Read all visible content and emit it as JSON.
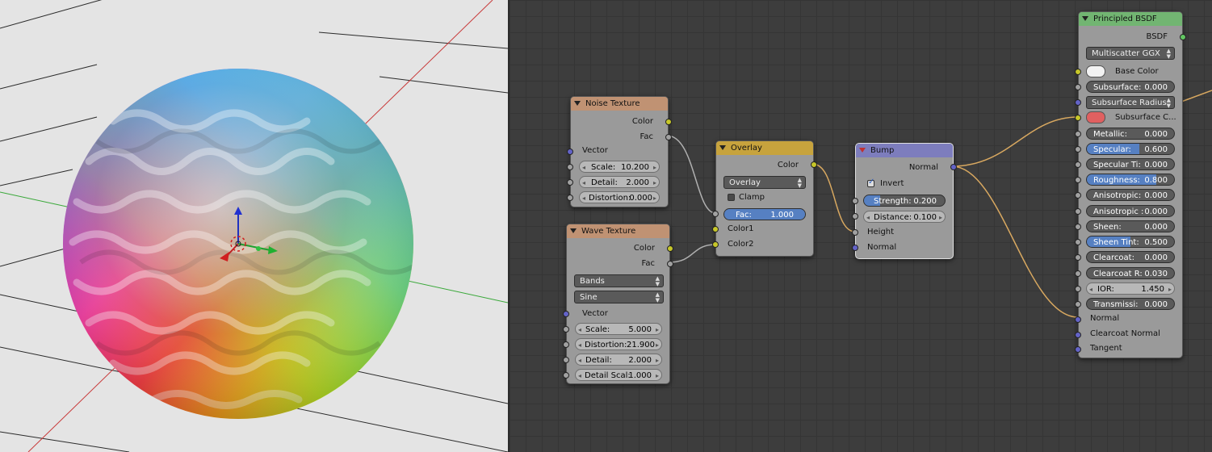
{
  "noise": {
    "title": "Noise Texture",
    "out_color": "Color",
    "out_fac": "Fac",
    "in_vector": "Vector",
    "scale_label": "Scale:",
    "scale_value": "10.200",
    "detail_label": "Detail:",
    "detail_value": "2.000",
    "distortion_label": "Distortion:",
    "distortion_value": "0.000"
  },
  "wave": {
    "title": "Wave Texture",
    "out_color": "Color",
    "out_fac": "Fac",
    "type_value": "Bands",
    "profile_value": "Sine",
    "in_vector": "Vector",
    "scale_label": "Scale:",
    "scale_value": "5.000",
    "distortion_label": "Distortion:",
    "distortion_value": "21.900",
    "detail_label": "Detail:",
    "detail_value": "2.000",
    "detail_scale_label": "Detail Scal:",
    "detail_scale_value": "1.000"
  },
  "overlay": {
    "title": "Overlay",
    "out_color": "Color",
    "blend_value": "Overlay",
    "clamp_label": "Clamp",
    "fac_label": "Fac:",
    "fac_value": "1.000",
    "fac_fraction": 1.0,
    "in_color1": "Color1",
    "in_color2": "Color2"
  },
  "bump": {
    "title": "Bump",
    "out_normal": "Normal",
    "invert_label": "Invert",
    "invert_checked": true,
    "strength_label": "Strength:",
    "strength_value": "0.200",
    "strength_fraction": 0.2,
    "distance_label": "Distance:",
    "distance_value": "0.100",
    "in_height": "Height",
    "in_normal": "Normal"
  },
  "bsdf": {
    "title": "Principled BSDF",
    "out_bsdf": "BSDF",
    "distribution_value": "Multiscatter GGX",
    "base_color_label": "Base Color",
    "base_color": "#f2f2f2",
    "subsurface_label": "Subsurface:",
    "subsurface_value": "0.000",
    "subsurface_radius_value": "Subsurface Radius",
    "subsurface_color_label": "Subsurface C...",
    "subsurface_color": "#e06060",
    "metallic_label": "Metallic:",
    "metallic_value": "0.000",
    "specular_label": "Specular:",
    "specular_value": "0.600",
    "specular_fraction": 0.6,
    "specular_tint_label": "Specular Ti:",
    "specular_tint_value": "0.000",
    "roughness_label": "Roughness:",
    "roughness_value": "0.800",
    "roughness_fraction": 0.8,
    "anisotropic_label": "Anisotropic:",
    "anisotropic_value": "0.000",
    "anisotropic_rot_label": "Anisotropic :",
    "anisotropic_rot_value": "0.000",
    "sheen_label": "Sheen:",
    "sheen_value": "0.000",
    "sheen_tint_label": "Sheen Tint:",
    "sheen_tint_value": "0.500",
    "sheen_tint_fraction": 0.5,
    "clearcoat_label": "Clearcoat:",
    "clearcoat_value": "0.000",
    "clearcoat_rough_label": "Clearcoat R:",
    "clearcoat_rough_value": "0.030",
    "ior_label": "IOR:",
    "ior_value": "1.450",
    "transmission_label": "Transmissi:",
    "transmission_value": "0.000",
    "in_normal": "Normal",
    "in_clearcoat_normal": "Clearcoat Normal",
    "in_tangent": "Tangent"
  },
  "colors": {
    "node_body": "#9a9a9a",
    "texture_header": "#c09273",
    "color_header": "#c7a33d",
    "vector_header": "#7d7dbd",
    "shader_header": "#72b572",
    "wire": "#d8a860",
    "wire_grey": "#b0b0b0",
    "editor_bg": "#3d3d3d",
    "viewport_bg": "#e4e4e4"
  },
  "viewport": {
    "gizmo_icons": [
      "z-axis-arrow-icon",
      "x-axis-arrow-icon",
      "y-axis-arrow-icon",
      "3d-cursor-icon"
    ]
  }
}
